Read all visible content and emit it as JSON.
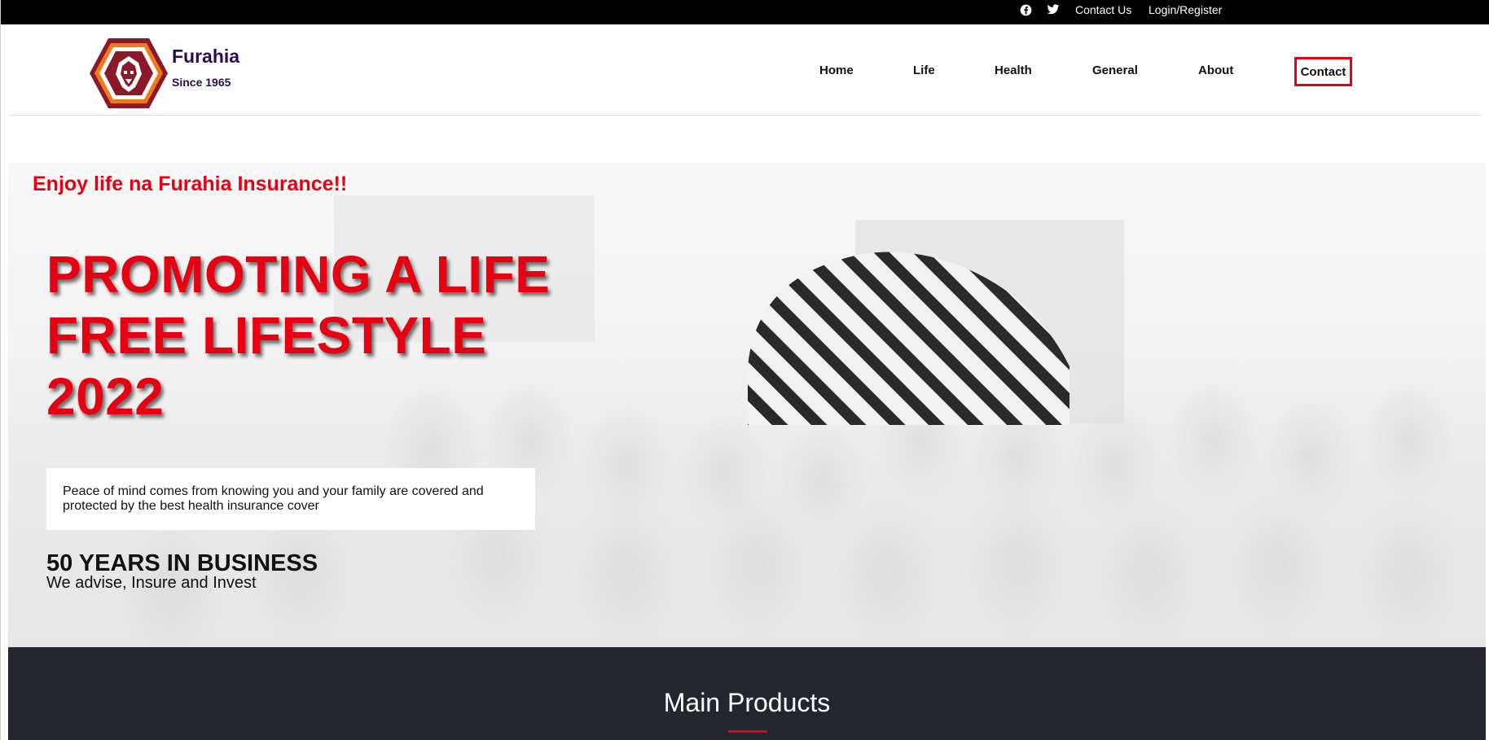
{
  "topbar": {
    "social": [
      {
        "icon": "facebook-icon"
      },
      {
        "icon": "twitter-icon"
      }
    ],
    "links": [
      "Contact Us",
      "Login/Register"
    ]
  },
  "brand": {
    "name": "Furahia",
    "since": "Since 1965",
    "logo_icon": "lion-logo-icon",
    "colors": {
      "primary": "#8a1a2a",
      "accent": "#f07a1a"
    }
  },
  "nav": {
    "items": [
      "Home",
      "Life",
      "Health",
      "General",
      "About"
    ],
    "contact": "Contact",
    "active_border": "#e60012"
  },
  "hero": {
    "tagline": "Enjoy life na Furahia Insurance!!",
    "title_lines": [
      "PROMOTING A LIFE",
      "FREE LIFESTYLE",
      "2022"
    ],
    "intro": "Peace of mind comes from knowing you and your family are covered and protected by the best health insurance cover",
    "years": "50 YEARS IN BUSINESS",
    "years_sub": "We advise, Insure and Invest",
    "accent": "#e60012",
    "placeholder_icon": "striped-image-placeholder-icon"
  },
  "products": {
    "title": "Main Products",
    "background": "#24262e"
  }
}
